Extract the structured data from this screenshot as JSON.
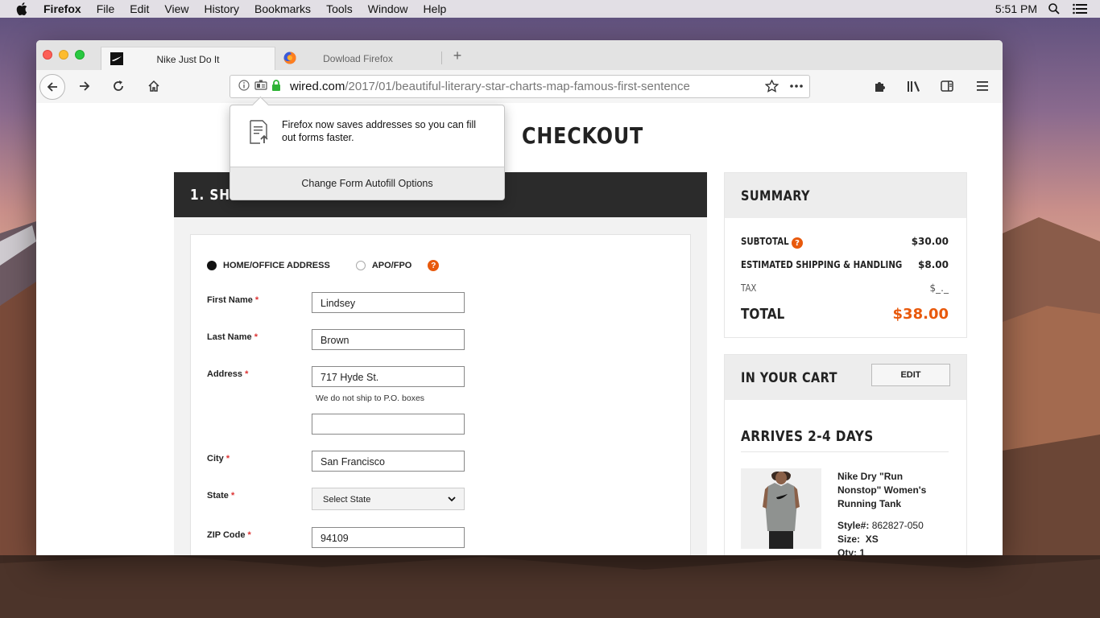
{
  "menubar": {
    "app": "Firefox",
    "items": [
      "File",
      "Edit",
      "View",
      "History",
      "Bookmarks",
      "Tools",
      "Window",
      "Help"
    ],
    "clock": "5:51 PM"
  },
  "tabs": [
    {
      "title": "Nike Just Do It",
      "favicon": "nike-swoosh-icon",
      "active": true
    },
    {
      "title": "Dowload Firefox",
      "favicon": "firefox-icon",
      "active": false
    }
  ],
  "address_bar": {
    "host": "wired.com",
    "path": "/2017/01/beautiful-literary-star-charts-map-famous-first-sentence"
  },
  "autofill_popup": {
    "message": "Firefox now saves addresses so you can fill out forms faster.",
    "button": "Change Form Autofill Options"
  },
  "page": {
    "title": "CHECKOUT",
    "shipping_header": "1. SHIPPING",
    "address_type": {
      "options": [
        "HOME/OFFICE ADDRESS",
        "APO/FPO"
      ],
      "selected": "HOME/OFFICE ADDRESS",
      "help": "?"
    },
    "required_mark": "*",
    "form": {
      "first_name": {
        "label": "First Name",
        "value": "Lindsey"
      },
      "last_name": {
        "label": "Last Name",
        "value": "Brown"
      },
      "address": {
        "label": "Address",
        "value": "717 Hyde St.",
        "note": "We do not ship to P.O. boxes",
        "line2": ""
      },
      "city": {
        "label": "City",
        "value": "San Francisco"
      },
      "state": {
        "label": "State",
        "value": "Select State"
      },
      "zip": {
        "label": "ZIP Code",
        "value": "94109"
      }
    }
  },
  "summary": {
    "header": "SUMMARY",
    "subtotal": {
      "label": "SUBTOTAL",
      "value": "$30.00"
    },
    "shipping": {
      "label": "ESTIMATED SHIPPING & HANDLING",
      "value": "$8.00"
    },
    "tax": {
      "label": "TAX",
      "value": "$_._"
    },
    "total": {
      "label": "TOTAL",
      "value": "$38.00"
    }
  },
  "cart": {
    "header": "IN YOUR CART",
    "edit": "EDIT",
    "arrives": "ARRIVES 2-4 DAYS",
    "product": {
      "name": "Nike Dry \"Run Nonstop\" Women's Running Tank",
      "style_label": "Style#:",
      "style": "862827-050",
      "size_label": "Size:",
      "size": "XS",
      "qty_label": "Qty:",
      "qty": "1"
    }
  },
  "colors": {
    "accent": "#e8590c",
    "header_dark": "#2b2b2b",
    "secure_lock": "#2fb336"
  }
}
